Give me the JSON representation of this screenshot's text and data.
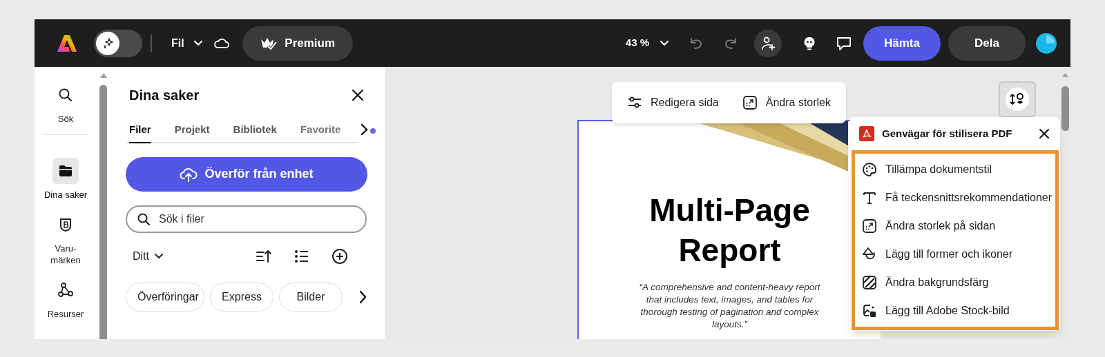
{
  "app_bar": {
    "mode_toggle": {
      "on": false
    },
    "menu": "Fil",
    "premium": "Premium",
    "zoom": "43 %",
    "download": "Hämta",
    "share": "Dela"
  },
  "rail": {
    "items": [
      {
        "kind": "search",
        "label": "Sök",
        "selected": false
      },
      {
        "kind": "folder",
        "label": "Dina saker",
        "selected": true
      },
      {
        "kind": "brand",
        "label": "Varu-\nmärken",
        "selected": false
      },
      {
        "kind": "graph",
        "label": "Resurser",
        "selected": false
      }
    ]
  },
  "panel": {
    "title": "Dina saker",
    "tabs": [
      {
        "label": "Filer",
        "selected": true
      },
      {
        "label": "Projekt",
        "selected": false
      },
      {
        "label": "Bibliotek",
        "selected": false
      },
      {
        "label": "Favorite",
        "selected": false
      }
    ],
    "upload_button": "Överför från enhet",
    "search": {
      "placeholder": "Sök i filer"
    },
    "filter": "Ditt",
    "chips": [
      "Överföringar",
      "Express",
      "Bilder"
    ]
  },
  "page_toolbar": [
    {
      "kind": "sliders",
      "label": "Redigera sida"
    },
    {
      "kind": "resize",
      "label": "Ändra storlek"
    }
  ],
  "document": {
    "title_lines": [
      "Multi-Page",
      "Report"
    ],
    "quote_lines": [
      "“A comprehensive and content-heavy report",
      "that includes text, images, and tables for",
      "thorough testing of pagination and complex",
      "layouts.”"
    ]
  },
  "shortcuts": {
    "title": "Genvägar för stilisera PDF",
    "items": [
      {
        "kind": "palette",
        "label": "Tillämpa dokumentstil"
      },
      {
        "kind": "text",
        "label": "Få teckensnittsrekommendationer"
      },
      {
        "kind": "resize",
        "label": "Ändra storlek på sidan"
      },
      {
        "kind": "shapes",
        "label": "Lägg till former och ikoner"
      },
      {
        "kind": "fill",
        "label": "Ändra bakgrundsfärg"
      },
      {
        "kind": "image",
        "label": "Lägg till Adobe Stock-bild"
      }
    ]
  }
}
